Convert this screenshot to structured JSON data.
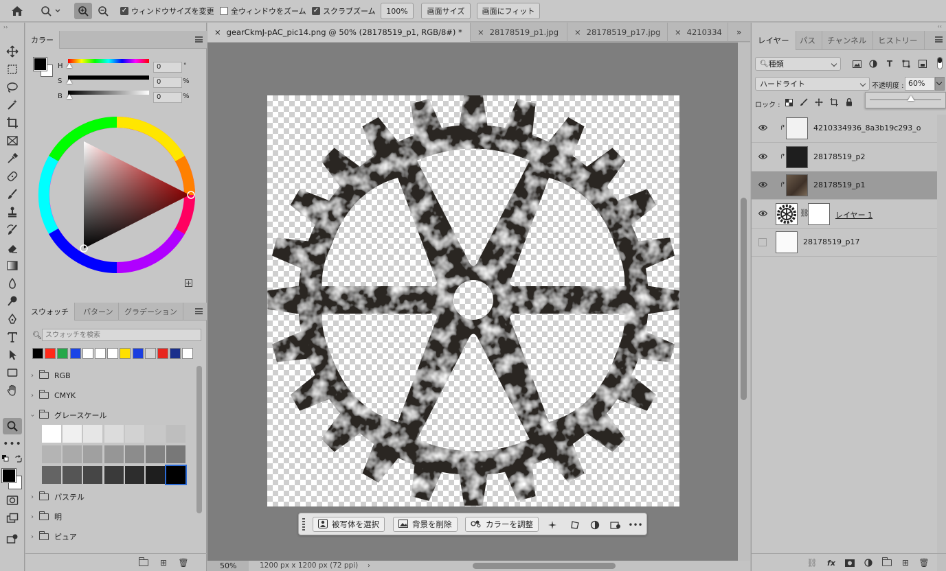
{
  "option_bar": {
    "checkbox_resize_windows": "ウィンドウサイズを変更",
    "checkbox_zoom_all": "全ウィンドウをズーム",
    "checkbox_scrubby": "スクラブズーム",
    "zoom_100": "100%",
    "fit_screen_size": "画面サイズ",
    "fit_screen": "画面にフィット"
  },
  "color_panel": {
    "tabs": [
      "カラー"
    ],
    "h_label": "H",
    "s_label": "S",
    "b_label": "B",
    "h_value": "0",
    "s_value": "0",
    "b_value": "0",
    "h_unit": "°",
    "s_unit": "%",
    "b_unit": "%"
  },
  "swatch_panel": {
    "tabs": [
      "スウォッチ",
      "パターン",
      "グラデーション"
    ],
    "search_placeholder": "スウォッチを検索",
    "swatch_colors": [
      "#000000",
      "#ff2a1a",
      "#25a84a",
      "#1a44e6",
      "#ffffff",
      "#ffffff",
      "#ffffff",
      "#ffe000",
      "#1a3ee0",
      "#d5d5d5",
      "#e8261f",
      "#1a2f8c",
      "#ffffff"
    ],
    "groups": [
      "RGB",
      "CMYK",
      "グレースケール",
      "パステル",
      "明",
      "ピュア"
    ],
    "gray_cells": [
      "#ffffff",
      "#f0f0f0",
      "#e6e6e6",
      "#dcdcdc",
      "#d2d2d2",
      "#c8c8c8",
      "#bebebe",
      "#b4b4b4",
      "#aaaaaa",
      "#a0a0a0",
      "#969696",
      "#8c8c8c",
      "#828282",
      "#787878",
      "#646464",
      "#555555",
      "#464646",
      "#3a3a3a",
      "#2d2d2d",
      "#1e1e1e",
      "#000000"
    ]
  },
  "document": {
    "tabs": [
      "gearCkmJ-pAC_pic14.png @ 50% (28178519_p1, RGB/8#) *",
      "28178519_p1.jpg",
      "28178519_p17.jpg",
      "4210334"
    ],
    "zoom": "50%",
    "doc_size": "1200 px x 1200 px (72 ppi)"
  },
  "context_bar": {
    "select_subject": "被写体を選択",
    "remove_bg": "背景を削除",
    "adjust_color": "カラーを調整"
  },
  "layers_panel": {
    "tabs": [
      "レイヤー",
      "パス",
      "チャンネル",
      "ヒストリー"
    ],
    "filter_kind": "種類",
    "blend_mode": "ハードライト",
    "opacity_label": "不透明度 :",
    "opacity_value": "60%",
    "lock_label": "ロック :",
    "layers": [
      {
        "name": "4210334936_8a3b19c293_o",
        "visible": true,
        "clipped": true
      },
      {
        "name": "28178519_p2",
        "visible": true,
        "clipped": true
      },
      {
        "name": "28178519_p1",
        "visible": true,
        "clipped": true,
        "selected": true
      },
      {
        "name": "レイヤー 1",
        "visible": true,
        "clipped": false
      },
      {
        "name": "28178519_p17",
        "visible": false,
        "clipped": false
      }
    ]
  }
}
